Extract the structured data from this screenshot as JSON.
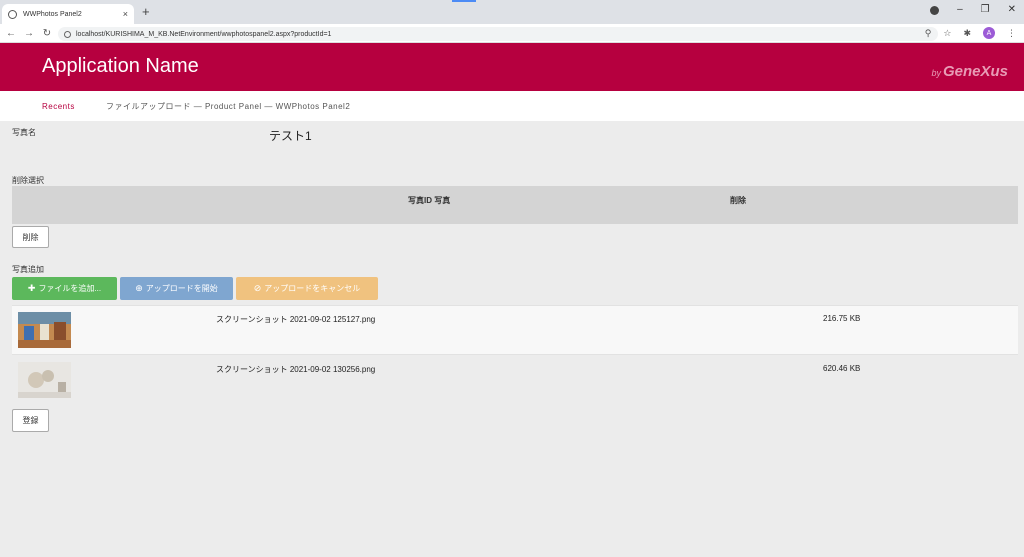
{
  "browser": {
    "tab_title": "WWPhotos Panel2",
    "tab_close": "×",
    "new_tab": "+",
    "url": "localhost/KURISHIMA_M_KB.NetEnvironment/wwphotospanel2.aspx?productId=1",
    "profile_initial": "A"
  },
  "header": {
    "app_name": "Application Name",
    "brand_prefix": "by",
    "brand": "GeneXus"
  },
  "breadcrumb": {
    "recents": "Recents",
    "path": "ファイルアップロード — Product Panel — WWPhotos Panel2"
  },
  "form": {
    "photo_name_label": "写真名",
    "photo_name_value": "テスト1",
    "delete_select_label": "削除選択",
    "grid_headers": [
      "写真ID 写真",
      "削除"
    ],
    "delete_button": "削除",
    "add_photo_label": "写真追加",
    "add_files_button": "ファイルを追加...",
    "start_upload_button": "アップロードを開始",
    "cancel_upload_button": "アップロードをキャンセル",
    "register_button": "登録"
  },
  "files": [
    {
      "name": "スクリーンショット 2021-09-02 125127.png",
      "size": "216.75 KB"
    },
    {
      "name": "スクリーンショット 2021-09-02 130256.png",
      "size": "620.46 KB"
    }
  ],
  "colors": {
    "brand": "#b6003f",
    "add_green": "#5cb85c",
    "start_blue": "#7fa6d0",
    "cancel_orange": "#f0c27f"
  }
}
